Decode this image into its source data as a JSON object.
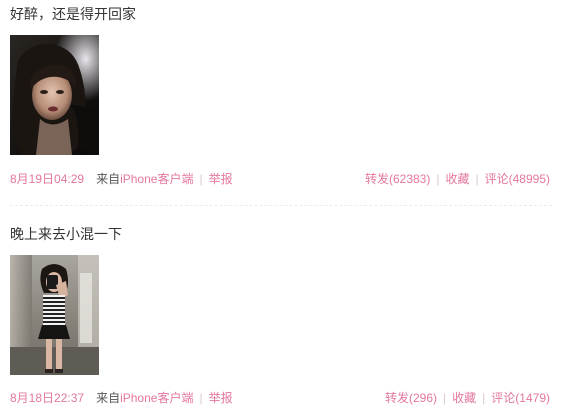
{
  "feed": {
    "posts": [
      {
        "text": "好醉，还是得开回家",
        "date": "8月19日04:29",
        "source_prefix": "来自",
        "source": "iPhone客户端",
        "report": "举报",
        "repost": "转发(62383)",
        "favorite": "收藏",
        "comment": "评论(48995)"
      },
      {
        "text": "晚上来去小混一下",
        "date": "8月18日22:37",
        "source_prefix": "来自",
        "source": "iPhone客户端",
        "report": "举报",
        "repost": "转发(296)",
        "favorite": "收藏",
        "comment": "评论(1479)"
      }
    ]
  },
  "colors": {
    "link": "#e4779f",
    "text": "#333333",
    "meta": "#555555",
    "separator": "#d8c8cf"
  }
}
